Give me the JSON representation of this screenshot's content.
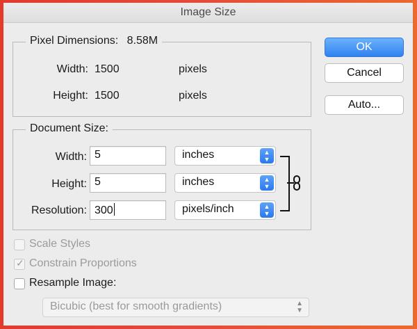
{
  "window": {
    "title": "Image Size"
  },
  "pixel_dimensions": {
    "legend": "Pixel Dimensions:",
    "size": "8.58M",
    "width_label": "Width:",
    "width_value": "1500",
    "width_unit": "pixels",
    "height_label": "Height:",
    "height_value": "1500",
    "height_unit": "pixels"
  },
  "document_size": {
    "legend": "Document Size:",
    "width_label": "Width:",
    "width_value": "5",
    "width_unit": "inches",
    "height_label": "Height:",
    "height_value": "5",
    "height_unit": "inches",
    "resolution_label": "Resolution:",
    "resolution_value": "300",
    "resolution_unit": "pixels/inch"
  },
  "buttons": {
    "ok": "OK",
    "cancel": "Cancel",
    "auto": "Auto..."
  },
  "options": {
    "scale_styles": {
      "label": "Scale Styles",
      "checked": false,
      "enabled": false
    },
    "constrain_proportions": {
      "label": "Constrain Proportions",
      "checked": true,
      "enabled": false
    },
    "resample_image": {
      "label": "Resample Image:",
      "checked": false,
      "enabled": true
    },
    "resample_method": "Bicubic (best for smooth gradients)"
  },
  "colors": {
    "accent": "#2f82f0",
    "window_bg": "#ececec",
    "frame": "#e5493a"
  },
  "icons": {
    "stepper": "up-down-chevron-icon",
    "link": "chain-link-icon",
    "check": "checkmark-icon"
  }
}
